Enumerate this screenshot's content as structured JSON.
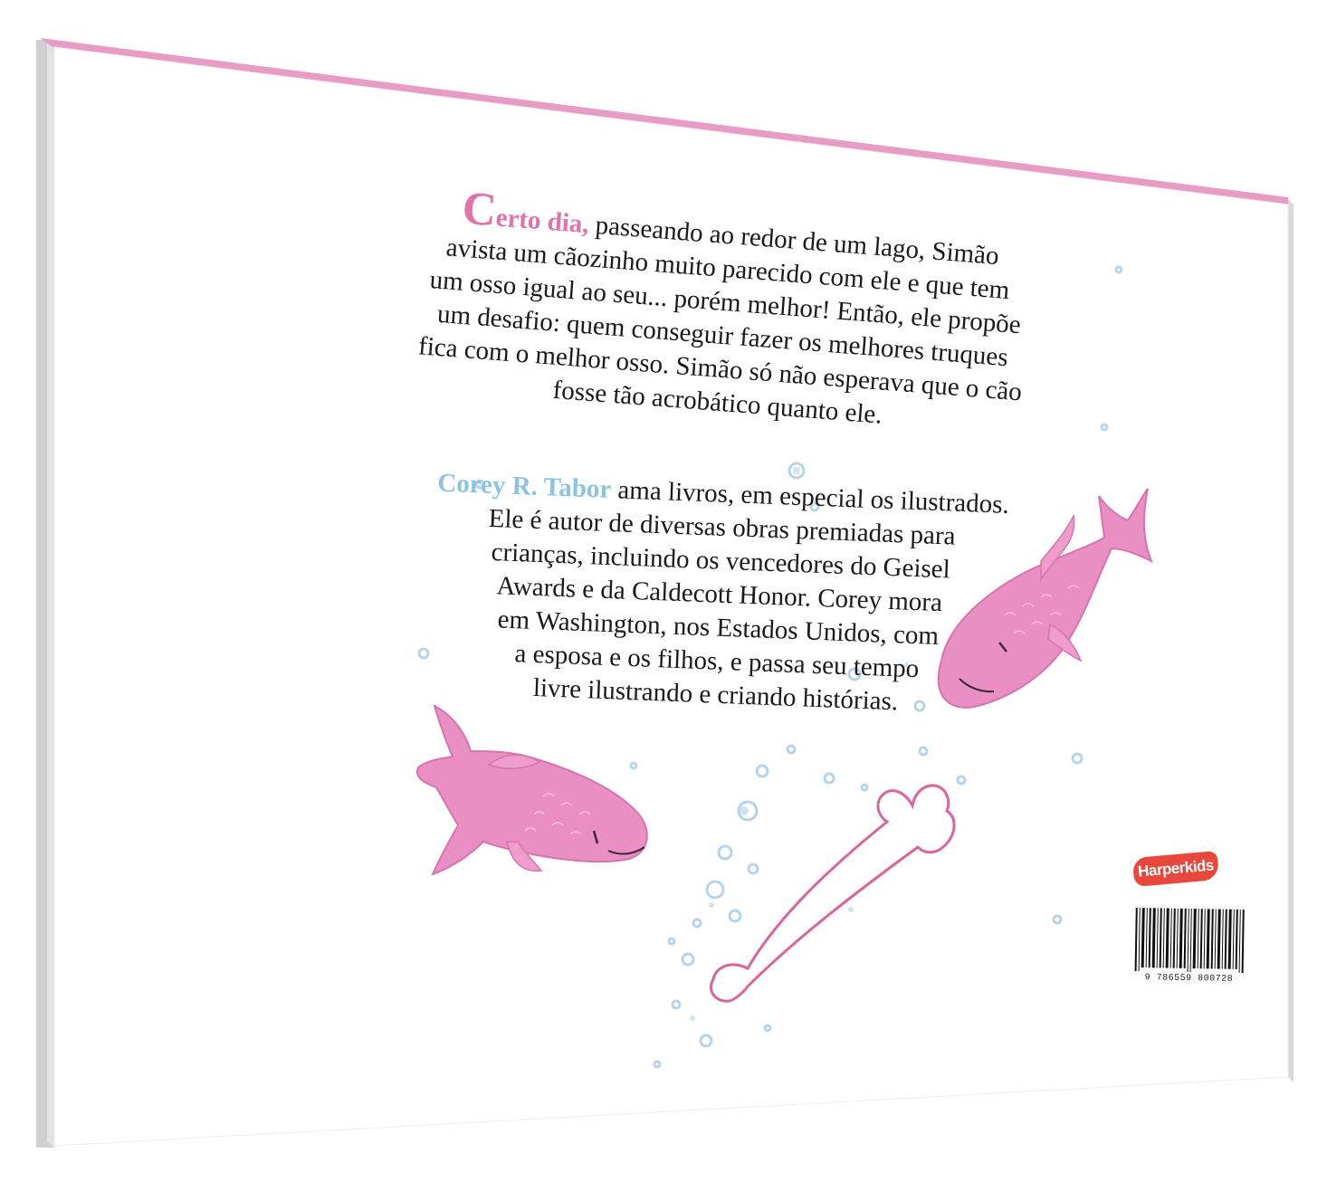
{
  "blurb": {
    "lead": "Certo dia,",
    "lines": [
      " passeando ao redor de um lago, Simão",
      "avista um cãozinho muito parecido com ele e que tem",
      "um osso igual ao seu... porém melhor! Então, ele propõe",
      "um desafio: quem conseguir fazer os melhores truques",
      "fica com o melhor osso. Simão só não esperava que o cão",
      "fosse tão acrobático quanto ele."
    ]
  },
  "bio": {
    "author": "Corey R. Tabor",
    "lines": [
      " ama livros, em especial os ilustrados.",
      "Ele é autor de diversas obras premiadas para",
      "crianças, incluindo os vencedores do Geisel",
      "Awards e da Caldecott Honor. Corey mora",
      "em Washington, nos Estados Unidos, com",
      "a esposa e os filhos, e passa seu tempo",
      "livre ilustrando e criando histórias."
    ]
  },
  "publisher": {
    "logo": "Harperkids"
  },
  "barcode": {
    "number": "9 786559 800728"
  },
  "colors": {
    "pink_accent": "#e273a9",
    "blue_accent": "#8cc2e4",
    "fish_pink": "#ea8fc3",
    "logo_red": "#e8473c",
    "page_edge_pink": "#e79bc5",
    "spine_gray": "#c9c9c9"
  },
  "icons": {
    "fish": "fish-illustration",
    "bone": "bone-illustration",
    "bubbles": "bubble-illustration"
  }
}
